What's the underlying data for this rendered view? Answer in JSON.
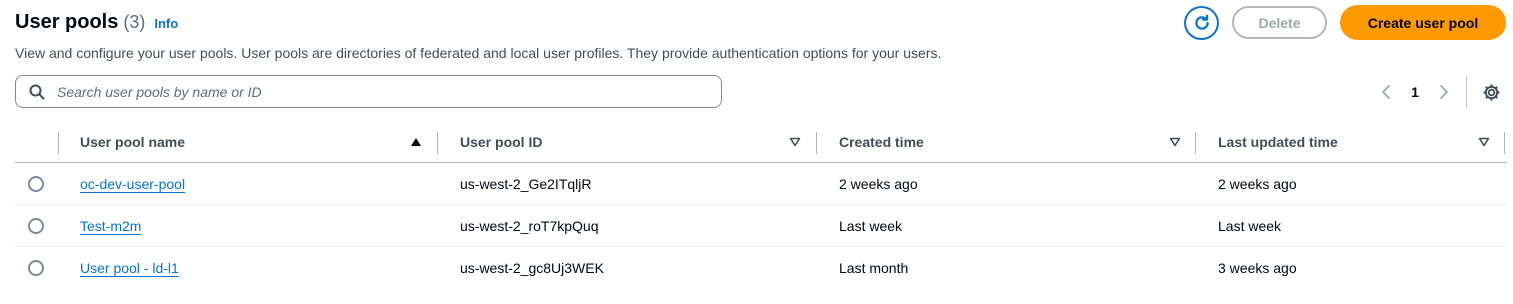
{
  "header": {
    "title": "User pools",
    "count": "(3)",
    "info_label": "Info",
    "description": "View and configure your user pools. User pools are directories of federated and local user profiles. They provide authentication options for your users."
  },
  "actions": {
    "refresh_icon": "refresh-icon",
    "delete_label": "Delete",
    "create_label": "Create user pool"
  },
  "search": {
    "placeholder": "Search user pools by name or ID",
    "value": ""
  },
  "pagination": {
    "current_page": "1"
  },
  "table": {
    "columns": [
      {
        "label": "User pool name",
        "sort": "ascending"
      },
      {
        "label": "User pool ID",
        "sort": "none"
      },
      {
        "label": "Created time",
        "sort": "none"
      },
      {
        "label": "Last updated time",
        "sort": "none"
      }
    ],
    "rows": [
      {
        "name": "oc-dev-user-pool",
        "id": "us-west-2_Ge2ITqljR",
        "created": "2 weeks ago",
        "updated": "2 weeks ago"
      },
      {
        "name": "Test-m2m",
        "id": "us-west-2_roT7kpQuq",
        "created": "Last week",
        "updated": "Last week"
      },
      {
        "name": "User pool - ld-l1",
        "id": "us-west-2_gc8Uj3WEK",
        "created": "Last month",
        "updated": "3 weeks ago"
      }
    ]
  },
  "colors": {
    "accent": "#0972d3",
    "primary_button": "#ff9900",
    "disabled_border": "#b4b4bb"
  }
}
